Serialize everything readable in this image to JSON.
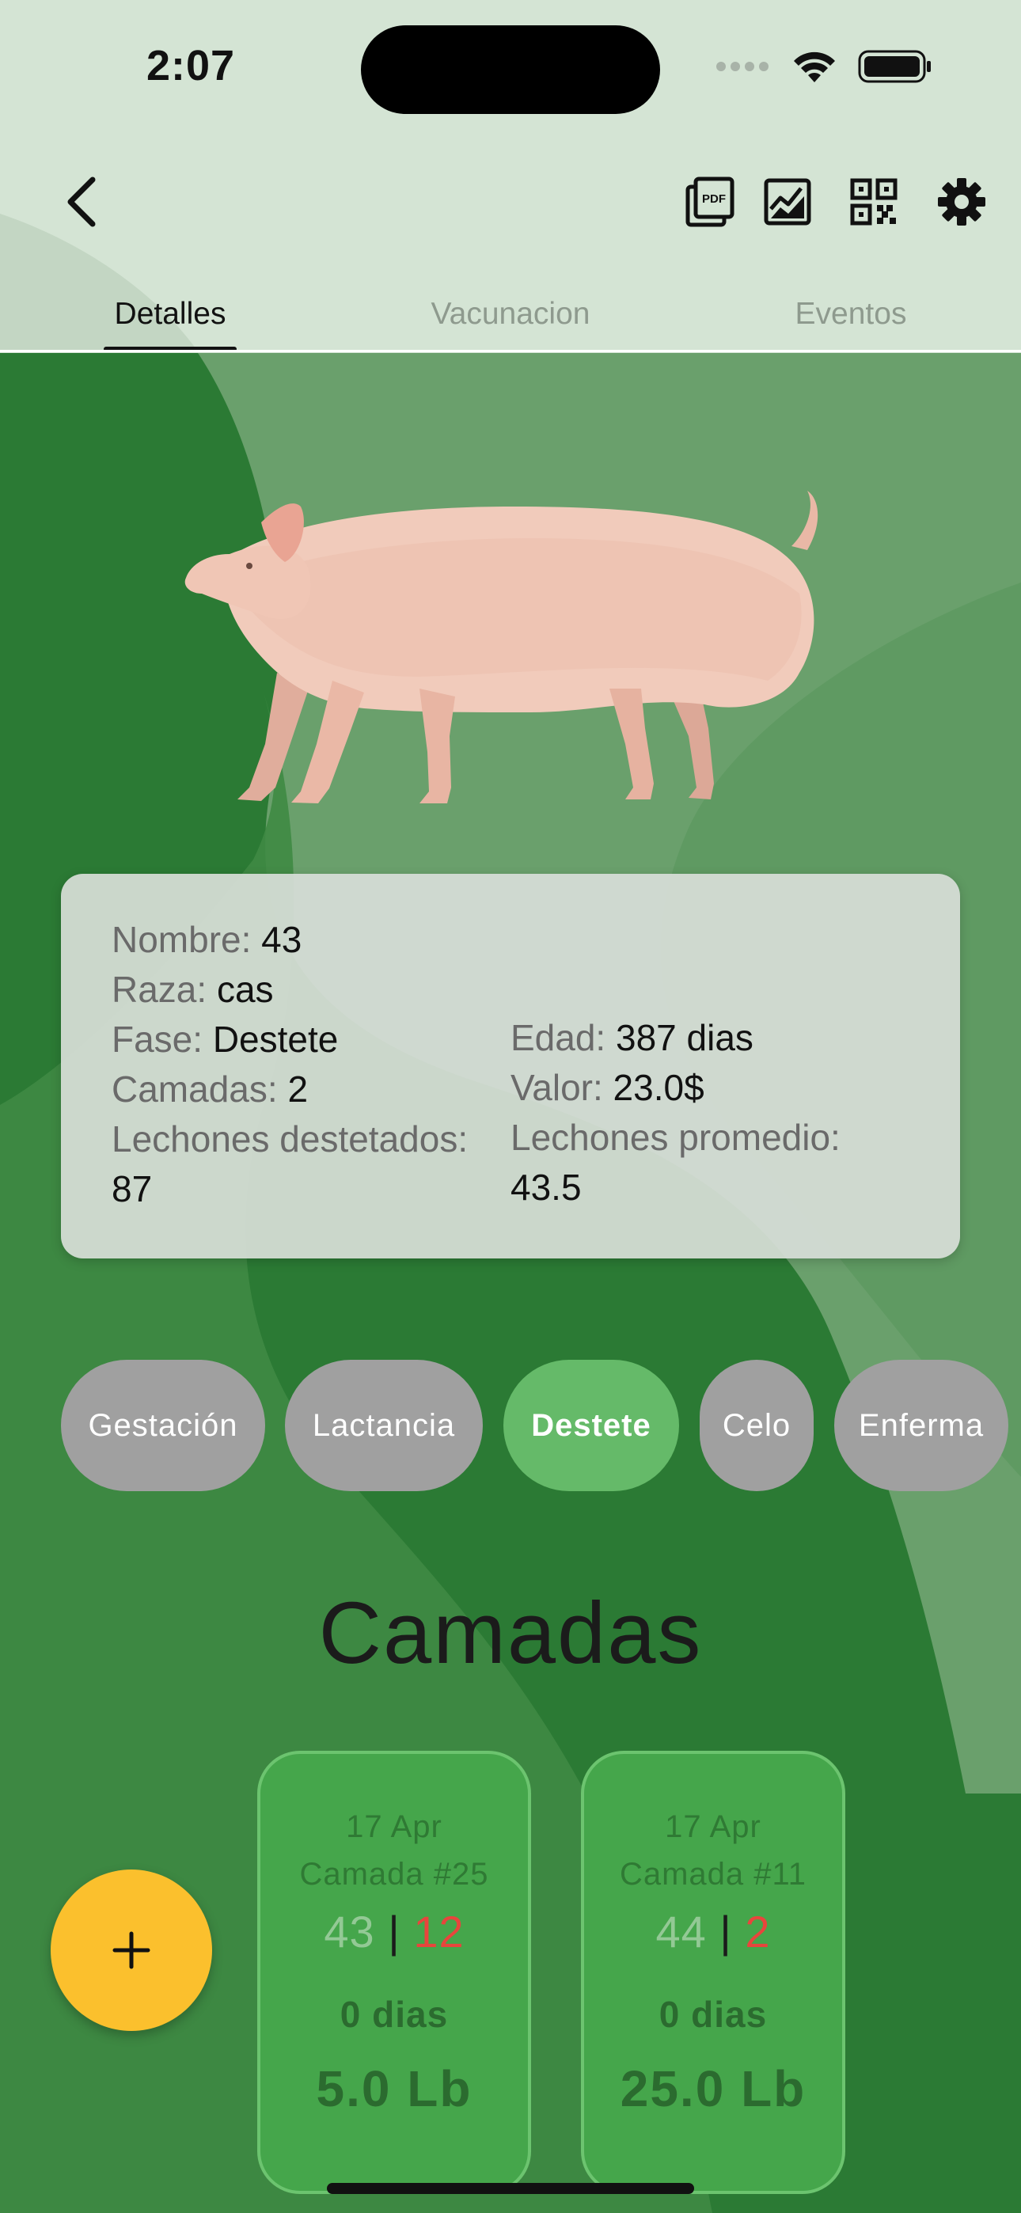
{
  "status_bar": {
    "time": "2:07"
  },
  "header": {
    "icons": [
      "back-arrow-icon",
      "pdf-icon",
      "chart-icon",
      "qr-code-icon",
      "gear-icon"
    ]
  },
  "tabs": [
    {
      "label": "Detalles",
      "active": true
    },
    {
      "label": "Vacunacion",
      "active": false
    },
    {
      "label": "Eventos",
      "active": false
    }
  ],
  "animal": {
    "image": "pig-photo",
    "name_label": "Nombre:",
    "name": "43",
    "breed_label": "Raza:",
    "breed": "cas",
    "phase_label": "Fase:",
    "phase": "Destete",
    "litters_label": "Camadas:",
    "litters": "2",
    "weaned_label": "Lechones destetados:",
    "weaned": "87",
    "age_label": "Edad:",
    "age": "387 dias",
    "value_label": "Valor:",
    "value": "23.0$",
    "avg_label": "Lechones promedio:",
    "avg": "43.5"
  },
  "phases": [
    {
      "label": "Gestación",
      "active": false
    },
    {
      "label": "Lactancia",
      "active": false
    },
    {
      "label": "Destete",
      "active": true
    },
    {
      "label": "Celo",
      "active": false
    },
    {
      "label": "Enferma",
      "active": false
    }
  ],
  "section_title": "Camadas",
  "litters": [
    {
      "date": "17 Apr",
      "name": "Camada #25",
      "count_a": "43",
      "count_b": "12",
      "days": "0 dias",
      "weight": "5.0 Lb"
    },
    {
      "date": "17 Apr",
      "name": "Camada #11",
      "count_a": "44",
      "count_b": "2",
      "days": "0 dias",
      "weight": "25.0 Lb"
    }
  ],
  "fab": {
    "icon": "plus-icon"
  },
  "colors": {
    "header_bg": "#d4e4d4",
    "body_bg": "#2b7a34",
    "chip_active": "#65ba69",
    "chip_inactive": "#a0a0a0",
    "fab": "#fbc02d",
    "count_highlight": "#e8453c"
  }
}
